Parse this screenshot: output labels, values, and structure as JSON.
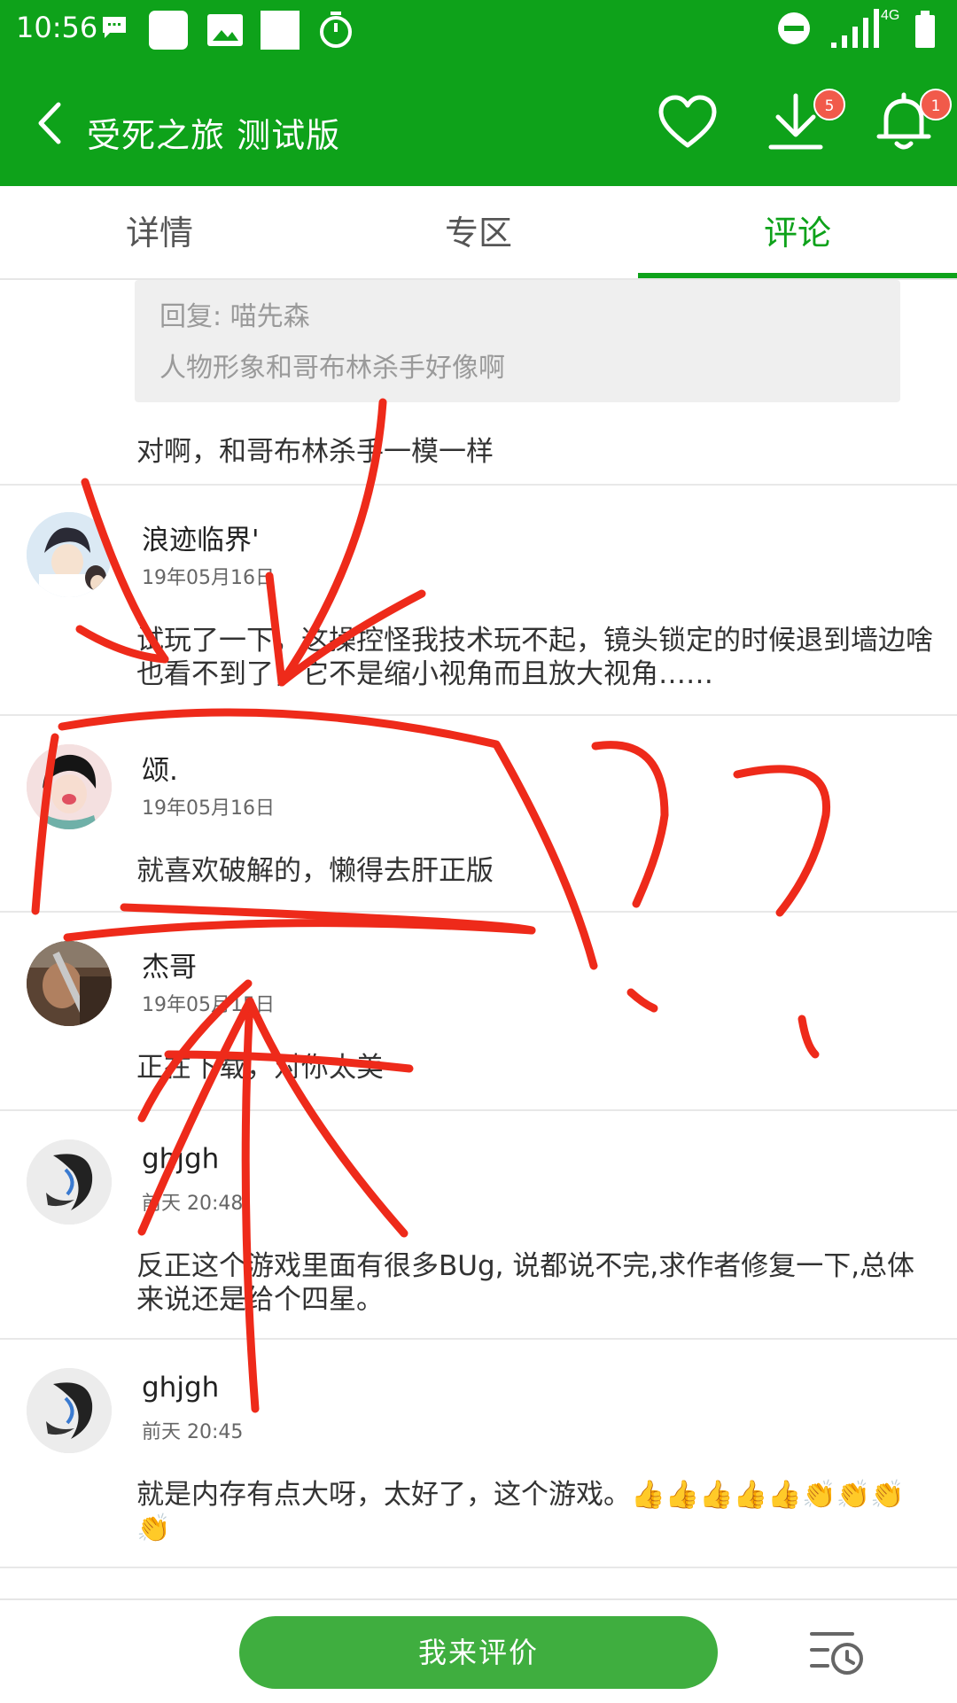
{
  "status_bar": {
    "time": "10:56",
    "network": "4G",
    "icons": [
      "message-icon",
      "image-icon",
      "timer-icon",
      "do-not-disturb-icon",
      "signal-icon",
      "battery-icon"
    ]
  },
  "header": {
    "title": "受死之旅 测试版",
    "download_badge": "5",
    "notification_badge": "1",
    "color": "#0ea21a"
  },
  "tabs": [
    {
      "label": "详情",
      "active": false
    },
    {
      "label": "专区",
      "active": false
    },
    {
      "label": "评论",
      "active": true
    }
  ],
  "first_comment": {
    "reply_to": "回复: 喵先森",
    "reply_text": "人物形象和哥布林杀手好像啊",
    "text": "对啊，和哥布林杀手一模一样"
  },
  "comments": [
    {
      "name": "浪迹临界'",
      "date": "19年05月16日",
      "text": "试玩了一下，这操控怪我技术玩不起，镜头锁定的时候退到墙边啥也看不到了，它不是缩小视角而且放大视角……"
    },
    {
      "name": "颂.",
      "date": "19年05月16日",
      "text": "就喜欢破解的，懒得去肝正版"
    },
    {
      "name": "杰哥",
      "date": "19年05月15日",
      "text": "正在下载，对你太美"
    },
    {
      "name": "ghjgh",
      "date": "前天 20:48",
      "text": "反正这个游戏里面有很多BUg, 说都说不完,求作者修复一下,总体来说还是给个四星。"
    },
    {
      "name": "ghjgh",
      "date": "前天 20:45",
      "text": "就是内存有点大呀，太好了，这个游戏。👍👍👍👍👍👏👏👏👏"
    }
  ],
  "bottom_bar": {
    "rate_label": "我来评价",
    "accent": "#3fae3f"
  }
}
